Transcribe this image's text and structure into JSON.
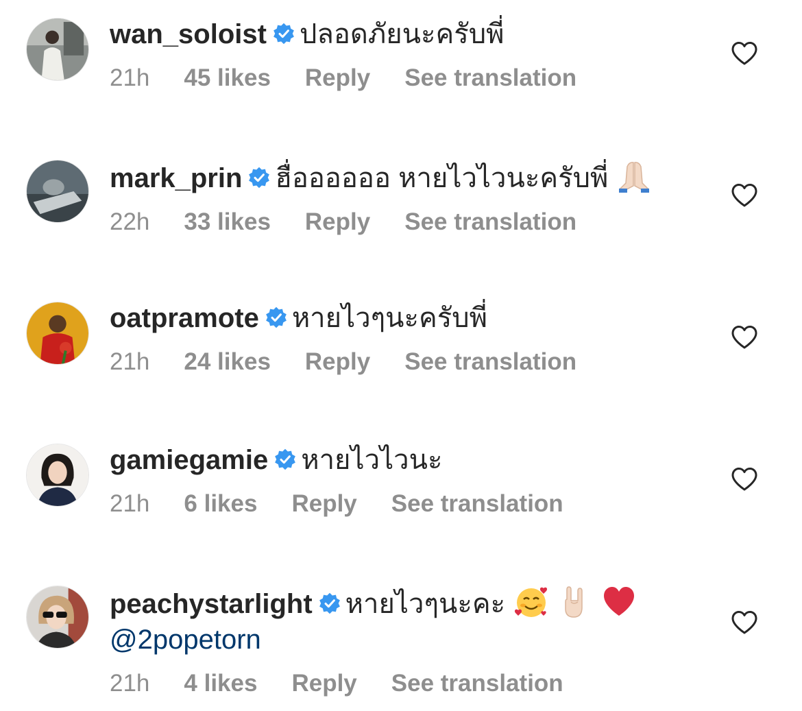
{
  "colors": {
    "text": "#262626",
    "meta": "#8e8e8e",
    "verified": "#3897f0",
    "mention": "#00376b"
  },
  "comments": [
    {
      "username": "wan_soloist",
      "text": "ปลอดภัยนะครับพี่",
      "time": "21h",
      "likes": "45 likes",
      "reply": "Reply",
      "translate": "See translation",
      "emojis": []
    },
    {
      "username": "mark_prin",
      "text": "ฮื่ออออออ หายไวไวนะครับพี่",
      "time": "22h",
      "likes": "33 likes",
      "reply": "Reply",
      "translate": "See translation",
      "emojis": [
        "folded-hands-emoji"
      ]
    },
    {
      "username": "oatpramote",
      "text": "หายไวๆนะครับพี่",
      "time": "21h",
      "likes": "24 likes",
      "reply": "Reply",
      "translate": "See translation",
      "emojis": []
    },
    {
      "username": "gamiegamie",
      "text": "หายไวไวนะ",
      "time": "21h",
      "likes": "6 likes",
      "reply": "Reply",
      "translate": "See translation",
      "emojis": []
    },
    {
      "username": "peachystarlight",
      "text": "หายไวๆนะคะ",
      "mention": "@2popetorn",
      "time": "21h",
      "likes": "4 likes",
      "reply": "Reply",
      "translate": "See translation",
      "emojis": [
        "smiling-face-with-hearts-emoji",
        "sign-of-horns-emoji",
        "red-heart-emoji"
      ]
    }
  ]
}
